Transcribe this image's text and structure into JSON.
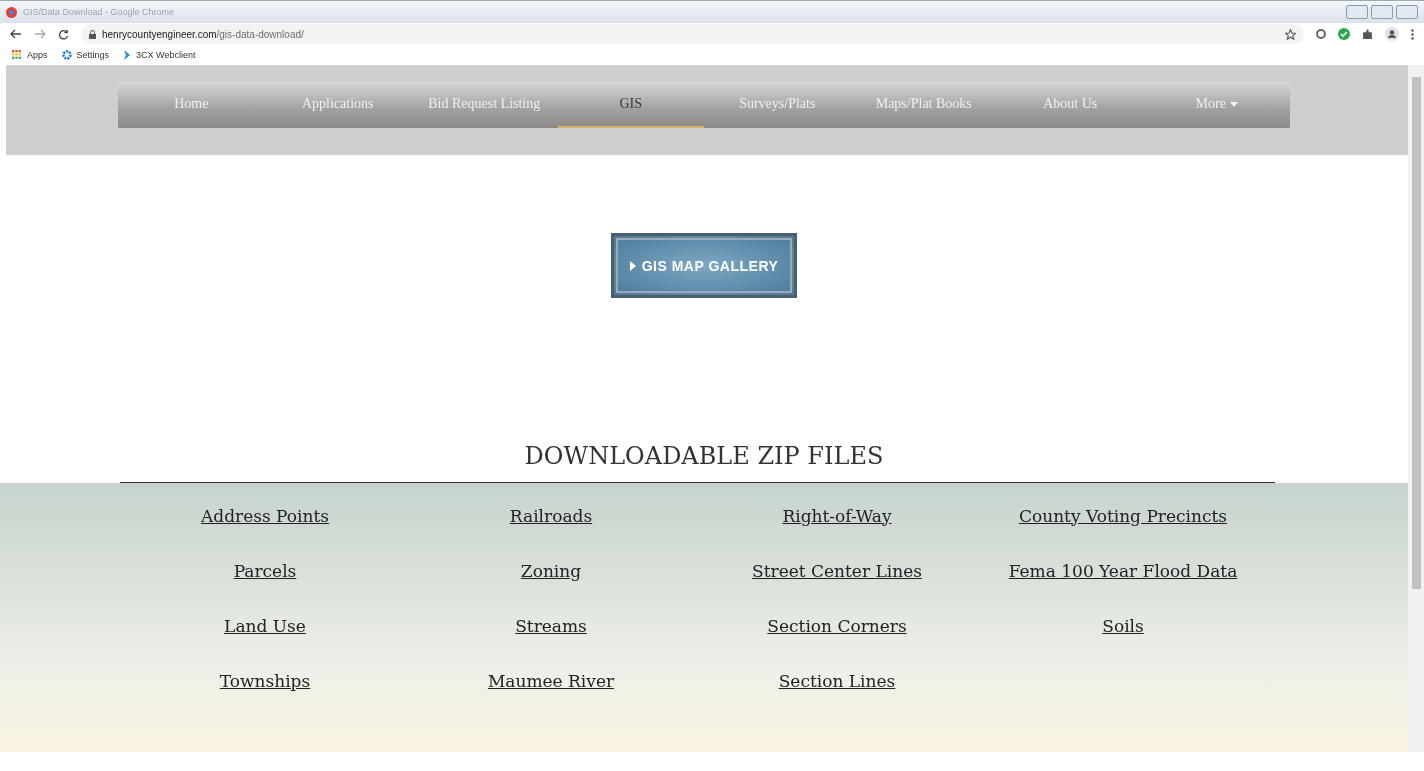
{
  "window": {
    "title": "GIS/Data Download - Google Chrome"
  },
  "address_bar": {
    "domain": "henrycountyengineer.com",
    "path": "/gis-data-download/"
  },
  "bookmarks": [
    {
      "label": "Apps",
      "kind": "apps"
    },
    {
      "label": "Settings",
      "kind": "gear"
    },
    {
      "label": "3CX Webclient",
      "kind": "chevron"
    }
  ],
  "nav": [
    {
      "label": "Home",
      "selected": false,
      "dropdown": false
    },
    {
      "label": "Applications",
      "selected": false,
      "dropdown": false
    },
    {
      "label": "Bid Request Listing",
      "selected": false,
      "dropdown": false
    },
    {
      "label": "GIS",
      "selected": true,
      "dropdown": false
    },
    {
      "label": "Surveys/Plats",
      "selected": false,
      "dropdown": false
    },
    {
      "label": "Maps/Plat Books",
      "selected": false,
      "dropdown": false
    },
    {
      "label": "About Us",
      "selected": false,
      "dropdown": false
    },
    {
      "label": "More",
      "selected": false,
      "dropdown": true
    }
  ],
  "gallery_button": {
    "label": "GIS MAP GALLERY"
  },
  "section_title": "DOWNLOADABLE ZIP FILES",
  "downloads": [
    [
      "Address Points",
      "Railroads",
      "Right-of-Way",
      "County Voting Precincts"
    ],
    [
      "Parcels",
      "Zoning",
      "Street Center Lines",
      "Fema 100 Year Flood Data"
    ],
    [
      "Land Use",
      "Streams",
      "Section Corners",
      "Soils"
    ],
    [
      "Townships",
      "Maumee River",
      "Section Lines"
    ]
  ]
}
